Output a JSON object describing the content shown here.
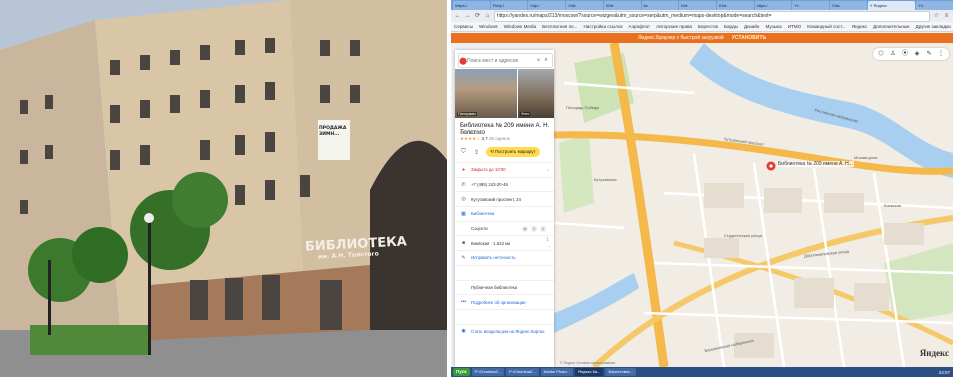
{
  "photo": {
    "sign_main": "БИБЛИОТЕКА",
    "sign_sub": "им. А.Н. Толстого",
    "window_banner": "ПРОДАЖА ЗИМН..."
  },
  "browser": {
    "tabs": [
      "Ihttps:/",
      "Fhttp:/",
      "http:/",
      "Xhtt:",
      "Kbtt:",
      "tw:",
      "Kbt:",
      "Kbd:",
      "https:/",
      "Yr:",
      "Vha:",
      "Y Яндекс",
      "Yx:"
    ],
    "active_tab_index": 11,
    "url": "https://yandex.ru/maps/213/moscow/?source=wizgeo&utm_source=serp&utm_medium=maps-desktop&mode=search&text=",
    "bookmarks": [
      "Сервисы",
      "Windows",
      "Windows Media",
      "Бесплатная по...",
      "Настройка ссылок",
      "Аэрофлот",
      "Авторские права",
      "Берестов",
      "Барды",
      "Дизайн",
      "Музыка",
      "ИТМО",
      "Командный сост...",
      "Яндекс",
      "Дополнительные",
      "Другие закладки"
    ]
  },
  "promo": {
    "text": "Яндекс.Браузер с быстрой загрузкой",
    "install": "УСТАНОВИТЬ"
  },
  "panel": {
    "search_placeholder": "Поиск мест и адресов",
    "photo_captions": [
      "Панорамы",
      "Фото"
    ],
    "title": "Библиотека № 209 имени А. Н. Толстого",
    "subtitle": "Библиотека",
    "rating_stars": "★★★★☆",
    "rating_value": "3,7",
    "rating_count": "25 оценок",
    "route_label": "Построить маршрут",
    "rows": [
      {
        "icon": "clock-icon",
        "glyph": "●",
        "text": "Закрыто до 10:00",
        "style": "red",
        "arrow": "⌄"
      },
      {
        "icon": "phone-icon",
        "glyph": "✆",
        "text": "+7 (495) 243-20-46",
        "style": "",
        "arrow": ""
      },
      {
        "icon": "location-icon",
        "glyph": "◎",
        "text": "Кутузовский проспект, 24",
        "style": "",
        "arrow": ""
      },
      {
        "icon": "building-icon",
        "glyph": "▦",
        "text": "Библиотека",
        "style": "link",
        "arrow": ""
      },
      {
        "icon": "share-icon",
        "glyph": "",
        "text": "Соцсети",
        "style": "",
        "arrow": ""
      },
      {
        "icon": "metro-icon",
        "glyph": "■",
        "text": "Киевская · 1,623 км",
        "style": "",
        "arrow": "1 →"
      },
      {
        "icon": "pencil-icon",
        "glyph": "✎",
        "text": "Исправить неточность",
        "style": "link",
        "arrow": ""
      },
      {
        "icon": "",
        "glyph": "",
        "text": "",
        "style": "",
        "arrow": ""
      },
      {
        "icon": "",
        "glyph": "",
        "text": "Публичная библиотека",
        "style": "",
        "arrow": ""
      },
      {
        "icon": "dots-icon",
        "glyph": "•••",
        "text": "Подробнее об организации",
        "style": "link",
        "arrow": ""
      },
      {
        "icon": "",
        "glyph": "",
        "text": "",
        "style": "",
        "arrow": ""
      },
      {
        "icon": "owner-icon",
        "glyph": "◉",
        "text": "Стать владельцем на Яндекс.Картах",
        "style": "link",
        "arrow": ""
      }
    ]
  },
  "map": {
    "pin_label": "Библиотека № 209 имени А. Н...",
    "labels": [
      "Кутузовский проспект",
      "Кутузовская",
      "Бережковская набережная",
      "Ростовская набережная",
      "Студенческая улица",
      "Киевская",
      "Площадь Победы",
      "Москва-река",
      "Дорогомиловская улица"
    ],
    "tools": [
      "⬡",
      "♙",
      "⦿",
      "◈",
      "✎",
      "⋮"
    ],
    "logo": "Яндекс",
    "footer": "© Яндекс  Условия использования"
  },
  "taskbar": {
    "start": "Пуск",
    "tasks": [
      "P:\\Chumina2...",
      "P:\\Chumina2...",
      "Adobe Photo...",
      "Яндекс.Ка...",
      "Берестовск..."
    ],
    "active_index": 3,
    "clock": "23:07"
  }
}
